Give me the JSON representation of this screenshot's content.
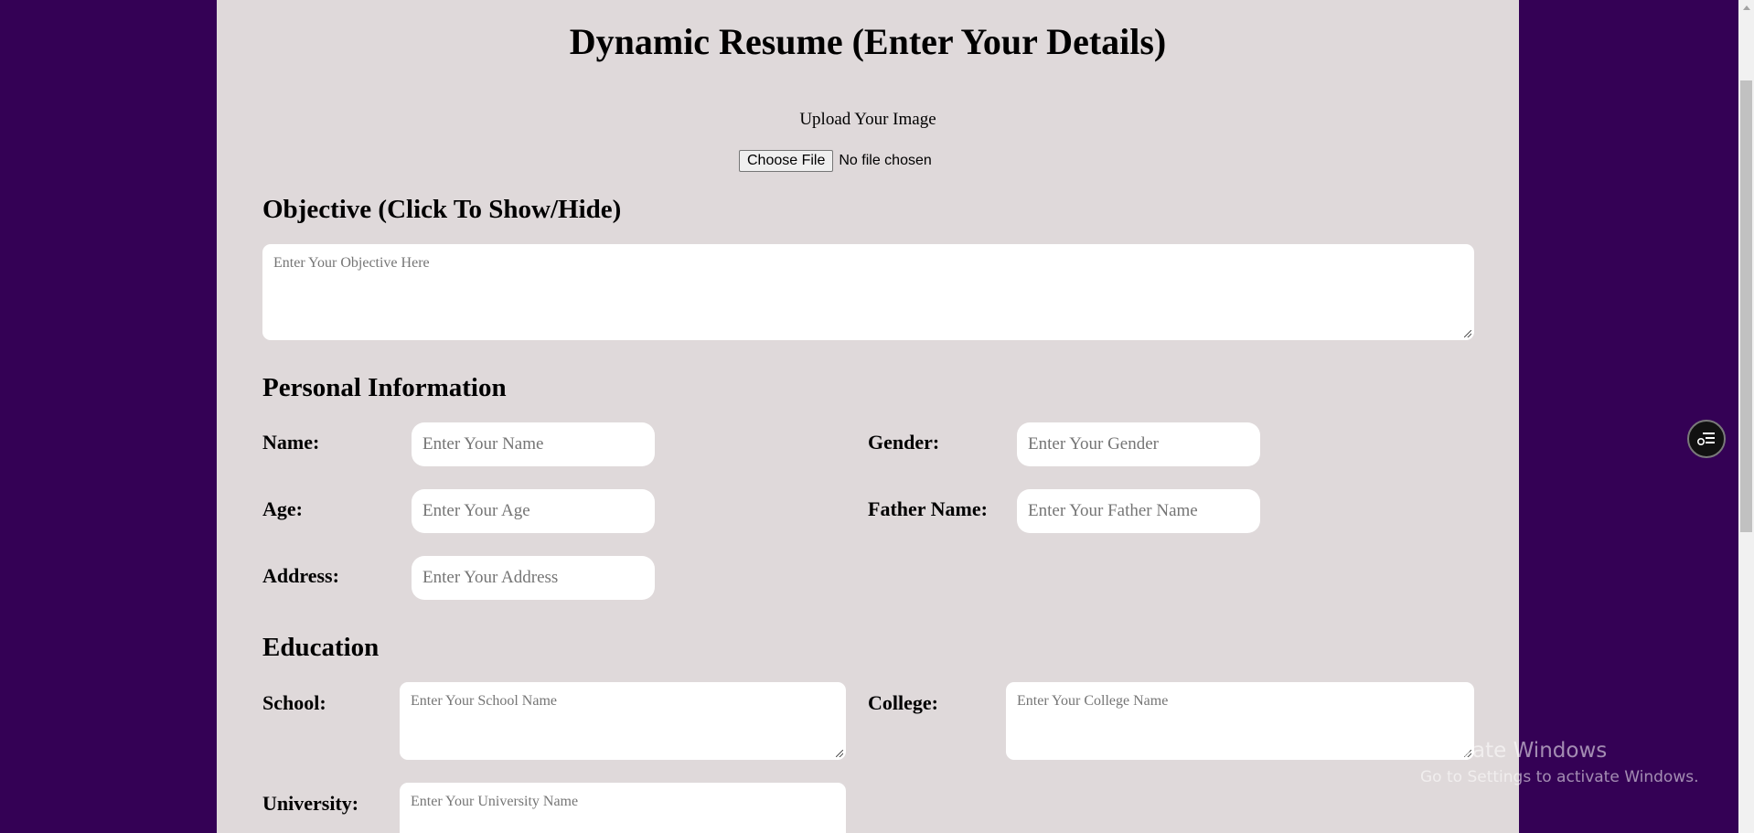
{
  "title": "Dynamic Resume (Enter Your Details)",
  "upload": {
    "label": "Upload Your Image",
    "button_label": "Choose File",
    "status": "No file chosen"
  },
  "objective": {
    "heading": "Objective (Click To Show/Hide)",
    "placeholder": "Enter Your Objective Here"
  },
  "personal": {
    "heading": "Personal Information",
    "name_label": "Name:",
    "name_placeholder": "Enter Your Name",
    "gender_label": "Gender:",
    "gender_placeholder": "Enter Your Gender",
    "age_label": "Age:",
    "age_placeholder": "Enter Your Age",
    "father_label": "Father Name:",
    "father_placeholder": "Enter Your Father Name",
    "address_label": "Address:",
    "address_placeholder": "Enter Your Address"
  },
  "education": {
    "heading": "Education",
    "school_label": "School:",
    "school_placeholder": "Enter Your School Name",
    "college_label": "College:",
    "college_placeholder": "Enter Your College Name",
    "university_label": "University:",
    "university_placeholder": "Enter Your University Name"
  },
  "watermark": {
    "title": "Activate Windows",
    "subtitle": "Go to Settings to activate Windows."
  },
  "colors": {
    "background": "#340155",
    "panel": "#dfd9da"
  }
}
